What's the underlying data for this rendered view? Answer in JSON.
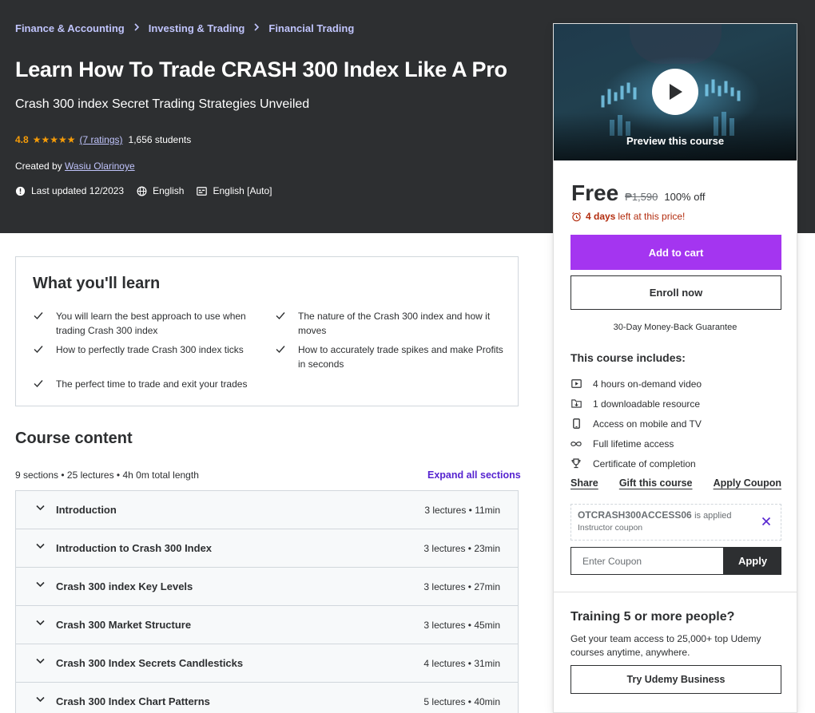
{
  "breadcrumb": [
    "Finance & Accounting",
    "Investing & Trading",
    "Financial Trading"
  ],
  "course": {
    "title": "Learn How To Trade CRASH 300 Index Like A Pro",
    "subtitle": "Crash 300 index Secret Trading Strategies Unveiled",
    "rating": "4.8",
    "ratings_link": "(7 ratings)",
    "students": "1,656 students",
    "created_by_label": "Created by",
    "instructor": "Wasiu Olarinoye",
    "last_updated": "Last updated 12/2023",
    "language": "English",
    "captions": "English [Auto]"
  },
  "sidebar": {
    "preview_label": "Preview this course",
    "price": "Free",
    "original_price": "₱1,590",
    "discount": "100% off",
    "timer_bold": "4 days",
    "timer_rest": "left at this price!",
    "add_to_cart": "Add to cart",
    "enroll_now": "Enroll now",
    "guarantee": "30-Day Money-Back Guarantee",
    "includes_title": "This course includes:",
    "includes": [
      {
        "icon": "video-icon",
        "label": "4 hours on-demand video"
      },
      {
        "icon": "download-icon",
        "label": "1 downloadable resource"
      },
      {
        "icon": "mobile-icon",
        "label": "Access on mobile and TV"
      },
      {
        "icon": "infinity-icon",
        "label": "Full lifetime access"
      },
      {
        "icon": "trophy-icon",
        "label": "Certificate of completion"
      }
    ],
    "share": "Share",
    "gift": "Gift this course",
    "apply_coupon": "Apply Coupon",
    "coupon_code": "OTCRASH300ACCESS06",
    "coupon_applied": "is applied",
    "coupon_type": "Instructor coupon",
    "coupon_placeholder": "Enter Coupon",
    "apply": "Apply",
    "team_title": "Training 5 or more people?",
    "team_desc": "Get your team access to 25,000+ top Udemy courses anytime, anywhere.",
    "business_button": "Try Udemy Business"
  },
  "learn": {
    "title": "What you'll learn",
    "items": [
      "You will learn the best approach to use when trading Crash 300 index",
      "The nature of the Crash 300 index and how it moves",
      "How to perfectly trade Crash 300 index ticks",
      "How to accurately trade spikes and make Profits in seconds",
      "The perfect time to trade and exit your trades"
    ]
  },
  "content": {
    "title": "Course content",
    "meta": "9 sections • 25 lectures • 4h 0m total length",
    "expand_all": "Expand all sections",
    "sections": [
      {
        "title": "Introduction",
        "meta": "3 lectures • 11min"
      },
      {
        "title": "Introduction to Crash 300 Index",
        "meta": "3 lectures • 23min"
      },
      {
        "title": "Crash 300 index Key Levels",
        "meta": "3 lectures • 27min"
      },
      {
        "title": "Crash 300 Market Structure",
        "meta": "3 lectures • 45min"
      },
      {
        "title": "Crash 300 Index Secrets Candlesticks",
        "meta": "4 lectures • 31min"
      },
      {
        "title": "Crash 300 Index Chart Patterns",
        "meta": "5 lectures • 40min"
      }
    ]
  },
  "colors": {
    "hero_bg": "#2d2f31",
    "link_light": "#c0c4fc",
    "star": "#f69c08",
    "purple": "#a435f0",
    "purple_text": "#5624d0",
    "timer_red": "#b32d0f"
  }
}
